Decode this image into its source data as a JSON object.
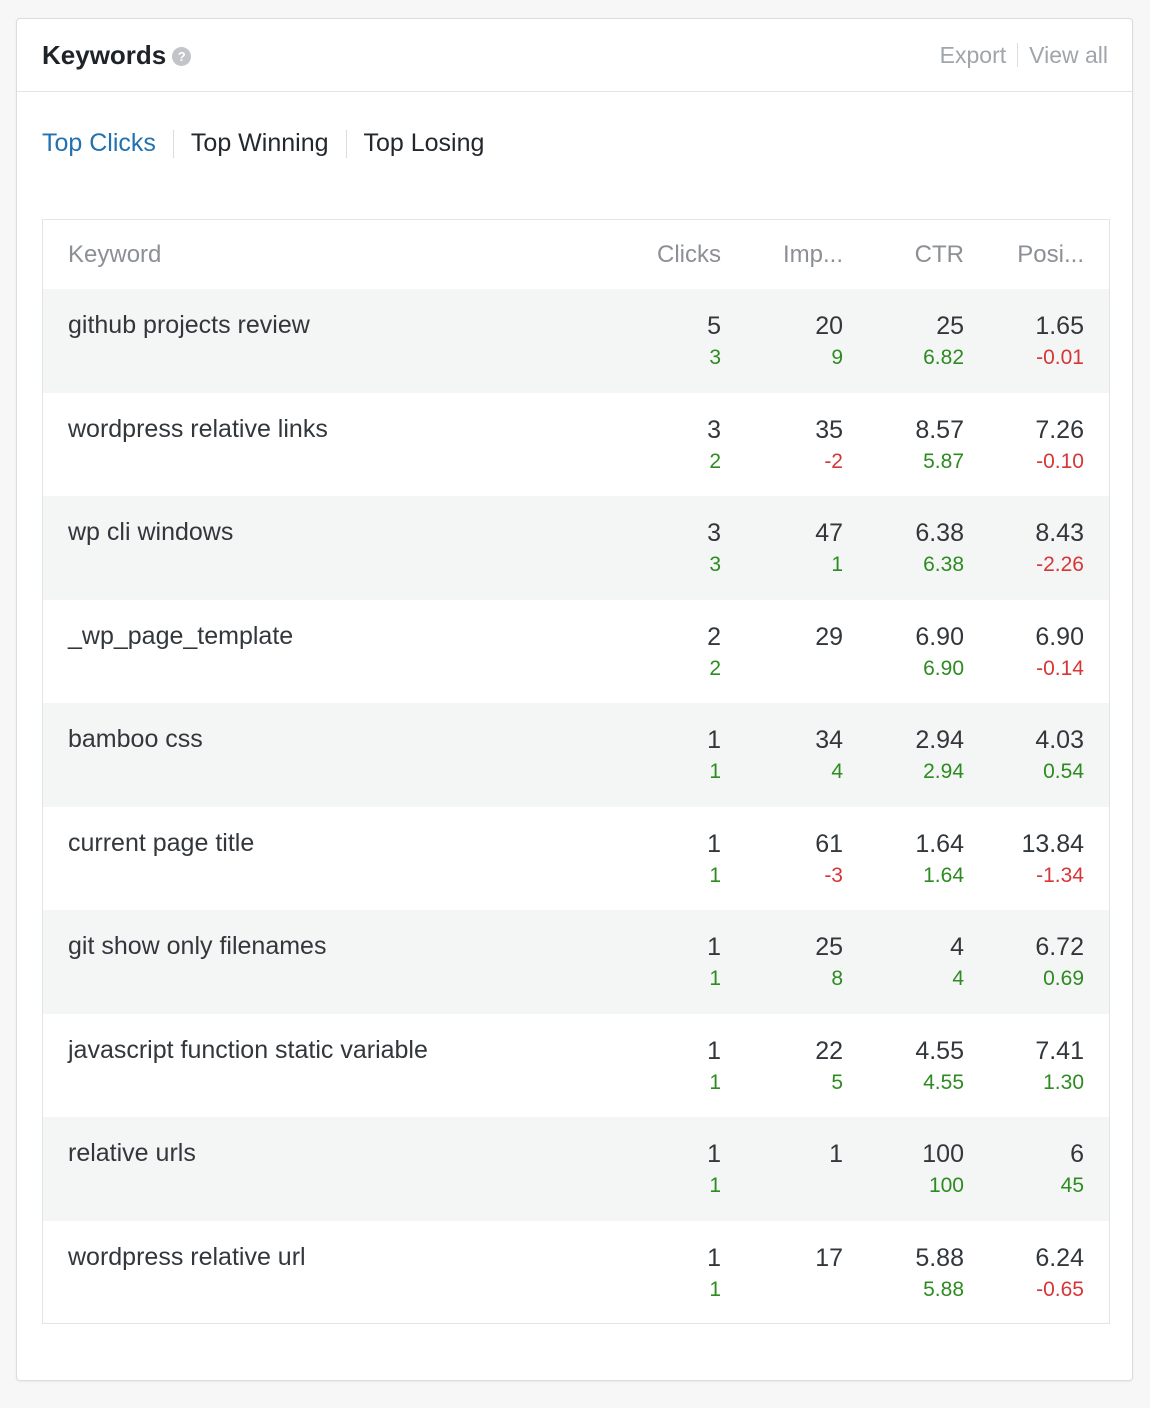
{
  "widget": {
    "title": "Keywords",
    "help_icon": "?",
    "export_label": "Export",
    "view_all_label": "View all"
  },
  "tabs": [
    "Top Clicks",
    "Top Winning",
    "Top Losing"
  ],
  "columns": [
    "Keyword",
    "Clicks",
    "Imp...",
    "CTR",
    "Posi..."
  ],
  "colors": {
    "positive": "#2e8b22",
    "negative": "#d63638",
    "accent": "#2271b1"
  },
  "rows": [
    {
      "keyword": "github projects review",
      "clicks": "5",
      "clicks_diff": "3",
      "imp": "20",
      "imp_diff": "9",
      "ctr": "25",
      "ctr_diff": "6.82",
      "pos": "1.65",
      "pos_diff": "-0.01"
    },
    {
      "keyword": "wordpress relative links",
      "clicks": "3",
      "clicks_diff": "2",
      "imp": "35",
      "imp_diff": "-2",
      "ctr": "8.57",
      "ctr_diff": "5.87",
      "pos": "7.26",
      "pos_diff": "-0.10"
    },
    {
      "keyword": "wp cli windows",
      "clicks": "3",
      "clicks_diff": "3",
      "imp": "47",
      "imp_diff": "1",
      "ctr": "6.38",
      "ctr_diff": "6.38",
      "pos": "8.43",
      "pos_diff": "-2.26"
    },
    {
      "keyword": "_wp_page_template",
      "clicks": "2",
      "clicks_diff": "2",
      "imp": "29",
      "imp_diff": "",
      "ctr": "6.90",
      "ctr_diff": "6.90",
      "pos": "6.90",
      "pos_diff": "-0.14"
    },
    {
      "keyword": "bamboo css",
      "clicks": "1",
      "clicks_diff": "1",
      "imp": "34",
      "imp_diff": "4",
      "ctr": "2.94",
      "ctr_diff": "2.94",
      "pos": "4.03",
      "pos_diff": "0.54"
    },
    {
      "keyword": "current page title",
      "clicks": "1",
      "clicks_diff": "1",
      "imp": "61",
      "imp_diff": "-3",
      "ctr": "1.64",
      "ctr_diff": "1.64",
      "pos": "13.84",
      "pos_diff": "-1.34"
    },
    {
      "keyword": "git show only filenames",
      "clicks": "1",
      "clicks_diff": "1",
      "imp": "25",
      "imp_diff": "8",
      "ctr": "4",
      "ctr_diff": "4",
      "pos": "6.72",
      "pos_diff": "0.69"
    },
    {
      "keyword": "javascript function static variable",
      "clicks": "1",
      "clicks_diff": "1",
      "imp": "22",
      "imp_diff": "5",
      "ctr": "4.55",
      "ctr_diff": "4.55",
      "pos": "7.41",
      "pos_diff": "1.30"
    },
    {
      "keyword": "relative urls",
      "clicks": "1",
      "clicks_diff": "1",
      "imp": "1",
      "imp_diff": "",
      "ctr": "100",
      "ctr_diff": "100",
      "pos": "6",
      "pos_diff": "45"
    },
    {
      "keyword": "wordpress relative url",
      "clicks": "1",
      "clicks_diff": "1",
      "imp": "17",
      "imp_diff": "",
      "ctr": "5.88",
      "ctr_diff": "5.88",
      "pos": "6.24",
      "pos_diff": "-0.65"
    }
  ]
}
